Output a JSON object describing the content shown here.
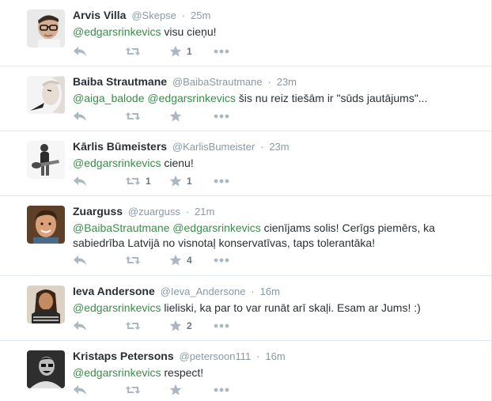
{
  "tweets": [
    {
      "fullname": "Arvis Villa",
      "username": "@Skepse",
      "time": "25m",
      "mentions": [
        "@edgarsrinkevics"
      ],
      "text": " visu cieņu!",
      "retweets": "",
      "favorites": "1",
      "avatar": {
        "bg": "#e6e6e6",
        "fg": "#c9a48a",
        "accent": "#3a2a1f"
      }
    },
    {
      "fullname": "Baiba Strautmane",
      "username": "@BaibaStrautmane",
      "time": "23m",
      "mentions": [
        "@aiga_balode",
        "@edgarsrinkevics"
      ],
      "text": " šis nu reiz tiešām ir \"sūds jautājums\"...",
      "retweets": "",
      "favorites": "",
      "avatar": {
        "bg": "#f2f2f2",
        "fg": "#d8d0c8",
        "accent": "#222222"
      }
    },
    {
      "fullname": "Kārlis Būmeisters",
      "username": "@KarlisBumeister",
      "time": "23m",
      "mentions": [
        "@edgarsrinkevics"
      ],
      "text": "  cienu!",
      "retweets": "1",
      "favorites": "1",
      "avatar": {
        "bg": "#f4f4f4",
        "fg": "#9a9a9a",
        "accent": "#2b2b2b"
      }
    },
    {
      "fullname": "Zuarguss",
      "username": "@zuarguss",
      "time": "21m",
      "mentions": [
        "@BaibaStrautmane",
        "@edgarsrinkevics"
      ],
      "text": " cienījams solis! Cerīgs piemērs, ka sabiedrība Latvijā no visnotaļ konservatīvas, taps tolerantāka!",
      "retweets": "",
      "favorites": "4",
      "avatar": {
        "bg": "#6b4a2e",
        "fg": "#d9a27a",
        "accent": "#3a2414"
      }
    },
    {
      "fullname": "Ieva Andersone",
      "username": "@Ieva_Andersone",
      "time": "16m",
      "mentions": [
        "@edgarsrinkevics"
      ],
      "text": " lieliski, ka par to var runāt arī skaļi. Esam ar Jums! :)",
      "retweets": "",
      "favorites": "2",
      "avatar": {
        "bg": "#d9cfc2",
        "fg": "#b07a55",
        "accent": "#2a1e16"
      }
    },
    {
      "fullname": "Kristaps Petersons",
      "username": "@petersoon111",
      "time": "16m",
      "mentions": [
        "@edgarsrinkevics"
      ],
      "text": " respect!",
      "retweets": "",
      "favorites": "",
      "avatar": {
        "bg": "#333333",
        "fg": "#cfcfcf",
        "accent": "#111111"
      }
    }
  ],
  "colors": {
    "mention": "#3b8c4a",
    "meta": "#8899a6",
    "icon": "#aab8c2",
    "divider": "#e1e8ed"
  },
  "icons": {
    "reply": "reply-icon",
    "retweet": "retweet-icon",
    "favorite": "star-icon",
    "more": "more-icon"
  }
}
